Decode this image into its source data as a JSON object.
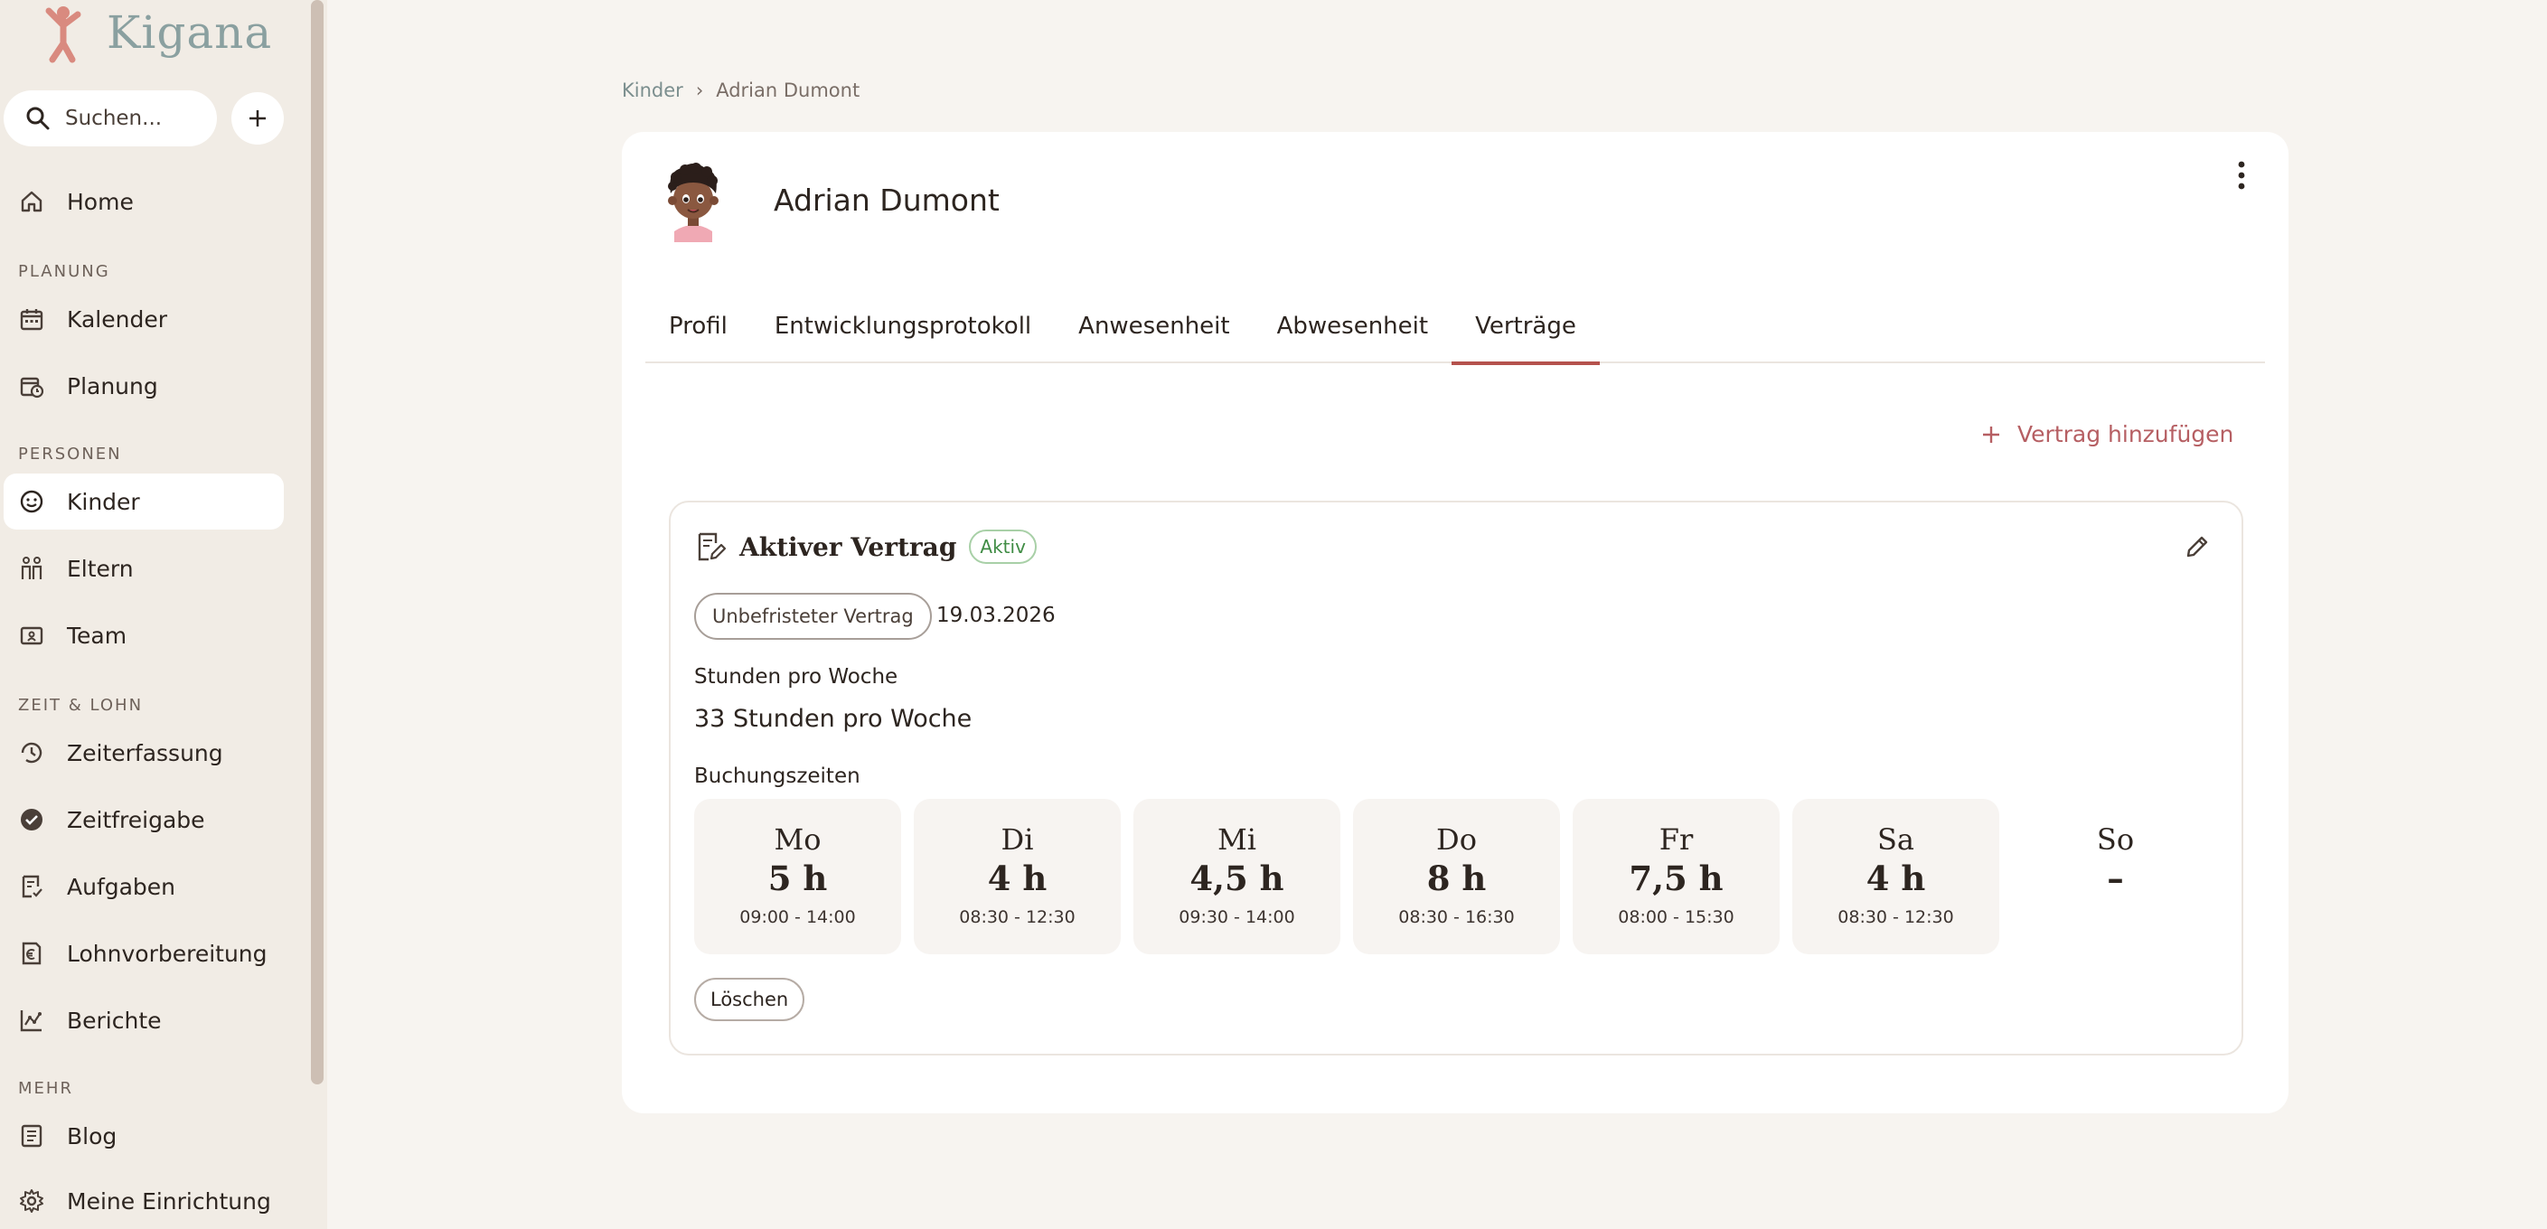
{
  "app": {
    "name": "Kigana"
  },
  "search": {
    "placeholder": "Suchen..."
  },
  "sidebar": {
    "home": "Home",
    "sections": {
      "planung": "PLANUNG",
      "personen": "PERSONEN",
      "zeit": "ZEIT & LOHN",
      "mehr": "MEHR"
    },
    "items": {
      "kalender": "Kalender",
      "planung": "Planung",
      "kinder": "Kinder",
      "eltern": "Eltern",
      "team": "Team",
      "zeiterfassung": "Zeiterfassung",
      "zeitfreigabe": "Zeitfreigabe",
      "aufgaben": "Aufgaben",
      "lohnvorbereitung": "Lohnvorbereitung",
      "berichte": "Berichte",
      "blog": "Blog",
      "einrichtung": "Meine Einrichtung"
    },
    "active": "kinder"
  },
  "breadcrumb": {
    "parent": "Kinder",
    "separator": "›",
    "current": "Adrian Dumont"
  },
  "child": {
    "name": "Adrian Dumont"
  },
  "tabs": [
    "Profil",
    "Entwicklungsprotokoll",
    "Anwesenheit",
    "Abwesenheit",
    "Verträge"
  ],
  "active_tab": "Verträge",
  "actions": {
    "add_contract": "Vertrag hinzufügen",
    "delete": "Löschen"
  },
  "contract": {
    "title": "Aktiver Vertrag",
    "status": "Aktiv",
    "type": "Unbefristeter Vertrag",
    "start_date": "19.03.2026",
    "hours_label": "Stunden pro Woche",
    "hours_value": "33 Stunden pro Woche",
    "booking_label": "Buchungszeiten",
    "days": [
      {
        "name": "Mo",
        "hours": "5 h",
        "time": "09:00 - 14:00"
      },
      {
        "name": "Di",
        "hours": "4 h",
        "time": "08:30 - 12:30"
      },
      {
        "name": "Mi",
        "hours": "4,5 h",
        "time": "09:30 - 14:00"
      },
      {
        "name": "Do",
        "hours": "8 h",
        "time": "08:30 - 16:30"
      },
      {
        "name": "Fr",
        "hours": "7,5 h",
        "time": "08:00 - 15:30"
      },
      {
        "name": "Sa",
        "hours": "4 h",
        "time": "08:30 - 12:30"
      },
      {
        "name": "So",
        "hours": "–",
        "time": ""
      }
    ]
  },
  "colors": {
    "accent": "#b5524d",
    "link": "#b65f63",
    "success": "#3f8c44",
    "sidebar_bg": "#f1ece5",
    "page_bg": "#f7f4f0"
  },
  "icons": {
    "search": "search-icon",
    "add": "plus-icon",
    "home": "home-icon",
    "kalender": "calendar-icon",
    "planung": "calendar-clock-icon",
    "kinder": "smiley-face-icon",
    "eltern": "parents-icon",
    "team": "team-badge-icon",
    "zeiterfassung": "clock-history-icon",
    "zeitfreigabe": "check-circle-icon",
    "aufgaben": "task-icon",
    "lohnvorbereitung": "payroll-euro-icon",
    "berichte": "chart-icon",
    "blog": "article-icon",
    "einrichtung": "gear-icon",
    "more": "more-vertical-icon",
    "edit": "pencil-icon",
    "contract": "contract-edit-icon"
  }
}
